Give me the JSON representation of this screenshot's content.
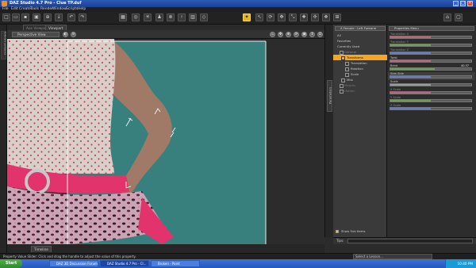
{
  "window": {
    "title": "DAZ Studio 4.7 Pro - Clue TP.duf"
  },
  "menu": [
    "File",
    "Edit",
    "Create",
    "Tools",
    "Render",
    "Window",
    "Scripts",
    "Help"
  ],
  "viewport": {
    "tabs": [
      "Aux Viewport",
      "Viewport"
    ],
    "camera": "Perspective View",
    "bottom_tab": "Timeline"
  },
  "dock": {
    "left_tab": "Content Library",
    "params_tab": "Parameters"
  },
  "parameters": {
    "node_selector": "A Female : Left Forearm",
    "filter": "Properties Menu",
    "tree": [
      {
        "label": "All",
        "level": 0
      },
      {
        "label": "Favorites",
        "level": 0
      },
      {
        "label": "Currently Used",
        "level": 0
      },
      {
        "label": "General",
        "level": 1
      },
      {
        "label": "Transforms",
        "level": 1,
        "selected": true
      },
      {
        "label": "Translation",
        "level": 2
      },
      {
        "label": "Rotation",
        "level": 2
      },
      {
        "label": "Scale",
        "level": 2
      },
      {
        "label": "Misc",
        "level": 1
      },
      {
        "label": "Morphs",
        "level": 1
      },
      {
        "label": "Hidden",
        "level": 1
      }
    ],
    "show_sub_items": "Show Sub Items",
    "sliders": [
      {
        "label": "Translation X",
        "color": "#c0627a",
        "fill": 0.5
      },
      {
        "label": "Translation Y",
        "color": "#6aa050",
        "fill": 0.5
      },
      {
        "label": "Translation Z",
        "color": "#6a7ac0",
        "fill": 0.5
      },
      {
        "label": "Twist",
        "color": "#c0627a",
        "fill": 0.5
      },
      {
        "label": "Bend",
        "color": "#6aa050",
        "fill": 0.55,
        "value": "40.37"
      },
      {
        "label": "Side-Side",
        "color": "#6a7ac0",
        "fill": 0.5
      },
      {
        "label": "Scale",
        "color": "#9a9a9a",
        "fill": 0.5
      },
      {
        "label": "X Scale",
        "color": "#c0627a",
        "fill": 0.5
      },
      {
        "label": "Y Scale",
        "color": "#6aa050",
        "fill": 0.5
      },
      {
        "label": "Z Scale",
        "color": "#6a7ac0",
        "fill": 0.5
      }
    ],
    "tips_label": "Tips:"
  },
  "status": {
    "message": "Property Value Slider: Click and drag the handle to adjust the value of this property.",
    "lesson": "Select a Lesson..."
  },
  "taskbar": {
    "start": "Start",
    "tasks": [
      "DAZ 3D Discussion Forum | ...",
      "DAZ Studio 4.7 Pro - Cl...",
      "Broken - Paint"
    ],
    "clock": "10:40 PM"
  }
}
